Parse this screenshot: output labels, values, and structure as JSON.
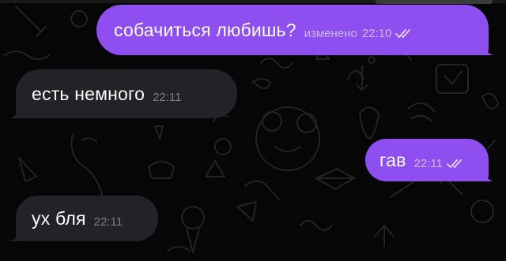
{
  "colors": {
    "background": "#060606",
    "outgoing_bubble": "#8f4ff0",
    "incoming_bubble": "#222228",
    "doodle_stroke": "#232323"
  },
  "messages": [
    {
      "direction": "outgoing",
      "text": "собачиться любишь?",
      "edited_label": "изменено",
      "time": "22:10",
      "read": true
    },
    {
      "direction": "incoming",
      "text": "есть немного",
      "time": "22:11"
    },
    {
      "direction": "outgoing",
      "text": "гав",
      "time": "22:11",
      "read": true
    },
    {
      "direction": "incoming",
      "text": "ух бля",
      "time": "22:11"
    }
  ],
  "icons": {
    "read_status": "double-check-icon",
    "background_pattern": "doodle-pattern"
  }
}
